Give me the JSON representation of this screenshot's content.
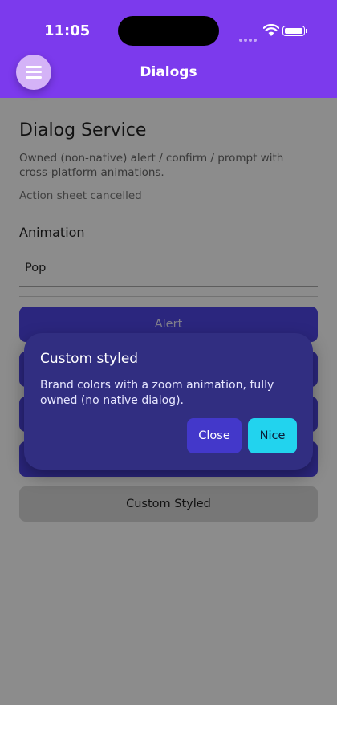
{
  "status_bar": {
    "time": "11:05"
  },
  "header": {
    "title": "Dialogs",
    "menu_icon": "hamburger-menu-icon"
  },
  "page": {
    "title": "Dialog Service",
    "description": "Owned (non-native) alert / confirm / prompt with cross-platform animations.",
    "status": "Action sheet cancelled"
  },
  "animation": {
    "label": "Animation",
    "selected": "Pop"
  },
  "buttons": {
    "alert": "Alert",
    "custom_styled": "Custom Styled"
  },
  "dialog": {
    "title": "Custom styled",
    "message": "Brand colors with a zoom animation, fully owned (no native dialog).",
    "close_label": "Close",
    "nice_label": "Nice"
  },
  "colors": {
    "brand": "#7c3aed",
    "primary_button": "#4f46e5",
    "dialog_bg": "#312e81",
    "accent": "#22d3ee"
  }
}
